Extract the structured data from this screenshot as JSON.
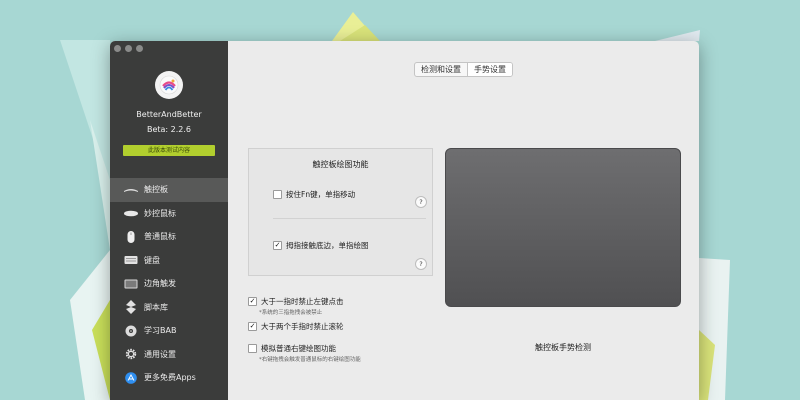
{
  "app": {
    "name": "BetterAndBetter",
    "version": "Beta: 2.2.6",
    "beta_notice": "此版本测试内容"
  },
  "sidebar": {
    "items": [
      {
        "label": "触控板",
        "icon": "trackpad-icon",
        "active": true
      },
      {
        "label": "妙控鼠标",
        "icon": "magic-mouse-icon",
        "active": false
      },
      {
        "label": "普通鼠标",
        "icon": "mouse-icon",
        "active": false
      },
      {
        "label": "键盘",
        "icon": "keyboard-icon",
        "active": false
      },
      {
        "label": "边角触发",
        "icon": "hot-corner-icon",
        "active": false
      },
      {
        "label": "脚本库",
        "icon": "script-icon",
        "active": false
      },
      {
        "label": "学习BAB",
        "icon": "learn-icon",
        "active": false
      },
      {
        "label": "通用设置",
        "icon": "gear-icon",
        "active": false
      },
      {
        "label": "更多免费Apps",
        "icon": "app-store-icon",
        "active": false
      }
    ]
  },
  "tabs": [
    {
      "label": "检测和设置",
      "selected": false
    },
    {
      "label": "手势设置",
      "selected": true
    }
  ],
  "draw_panel": {
    "title": "触控板绘图功能",
    "options": [
      {
        "label": "按住Fn键，单指移动",
        "checked": false
      },
      {
        "label": "拇指接触底边，单指绘图",
        "checked": true
      }
    ],
    "help_label": "?"
  },
  "options": [
    {
      "label": "大于一指时禁止左键点击",
      "sub": "*系统的三指拖拽会被禁止",
      "checked": true
    },
    {
      "label": "大于两个手指时禁止滚轮",
      "sub": "",
      "checked": true
    },
    {
      "label": "模拟普通右键绘图功能",
      "sub": "*右键拖拽会触发普通鼠标的右键绘图功能",
      "checked": false
    }
  ],
  "trackpad_label": "触控板手势检测",
  "colors": {
    "sidebar_bg": "#3b3c3b",
    "sidebar_active": "#585958",
    "beta_badge": "#b2cf2e",
    "content_bg": "#ebebeb",
    "trackpad": "#5f5f61",
    "wallpaper": "#a7d7d3"
  }
}
